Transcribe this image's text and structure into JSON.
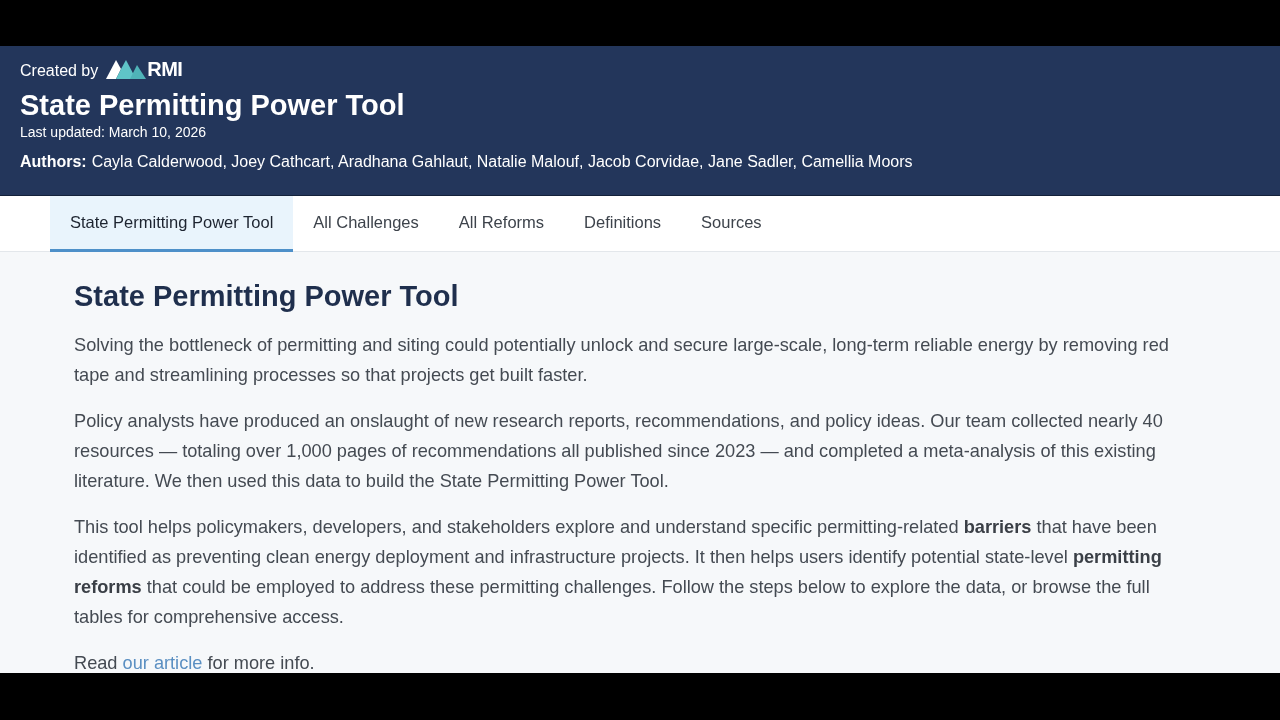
{
  "header": {
    "credit": "Created by",
    "logo_text": "RMI",
    "title": "State Permitting Power Tool",
    "updated": "Last updated: March 10, 2026",
    "authors_label": "Authors:",
    "authors": "Cayla Calderwood, Joey Cathcart, Aradhana Gahlaut, Natalie Malouf, Jacob Corvidae, Jane Sadler, Camellia Moors"
  },
  "tabs": [
    {
      "label": "State Permitting Power Tool",
      "selected": true
    },
    {
      "label": "All Challenges",
      "selected": false
    },
    {
      "label": "All Reforms",
      "selected": false
    },
    {
      "label": "Definitions",
      "selected": false
    },
    {
      "label": "Sources",
      "selected": false
    }
  ],
  "content": {
    "heading": "State Permitting Power Tool",
    "paragraphs": [
      "Solving the bottleneck of permitting and siting could potentially unlock and secure large-scale, long-term reliable energy by removing red tape and streamlining processes so that projects get built faster.",
      "Policy analysts have produced an onslaught of new research reports, recommendations, and policy ideas. Our team collected nearly 40 resources — totaling over 1,000 pages of recommendations all published since 2023 — and completed a meta-analysis of this existing literature. We then used this data to build the State Permitting Power Tool.",
      "This tool helps policymakers, developers, and stakeholders explore and understand specific permitting-related **barriers** that have been identified as preventing clean energy deployment and infrastructure projects. It then helps users identify potential state-level **permitting reforms** that could be employed to address these permitting challenges. Follow the steps below to explore the data, or browse the full tables for comprehensive access."
    ],
    "closing": {
      "before": "Read ",
      "link": "our article",
      "after": " for more info."
    }
  }
}
